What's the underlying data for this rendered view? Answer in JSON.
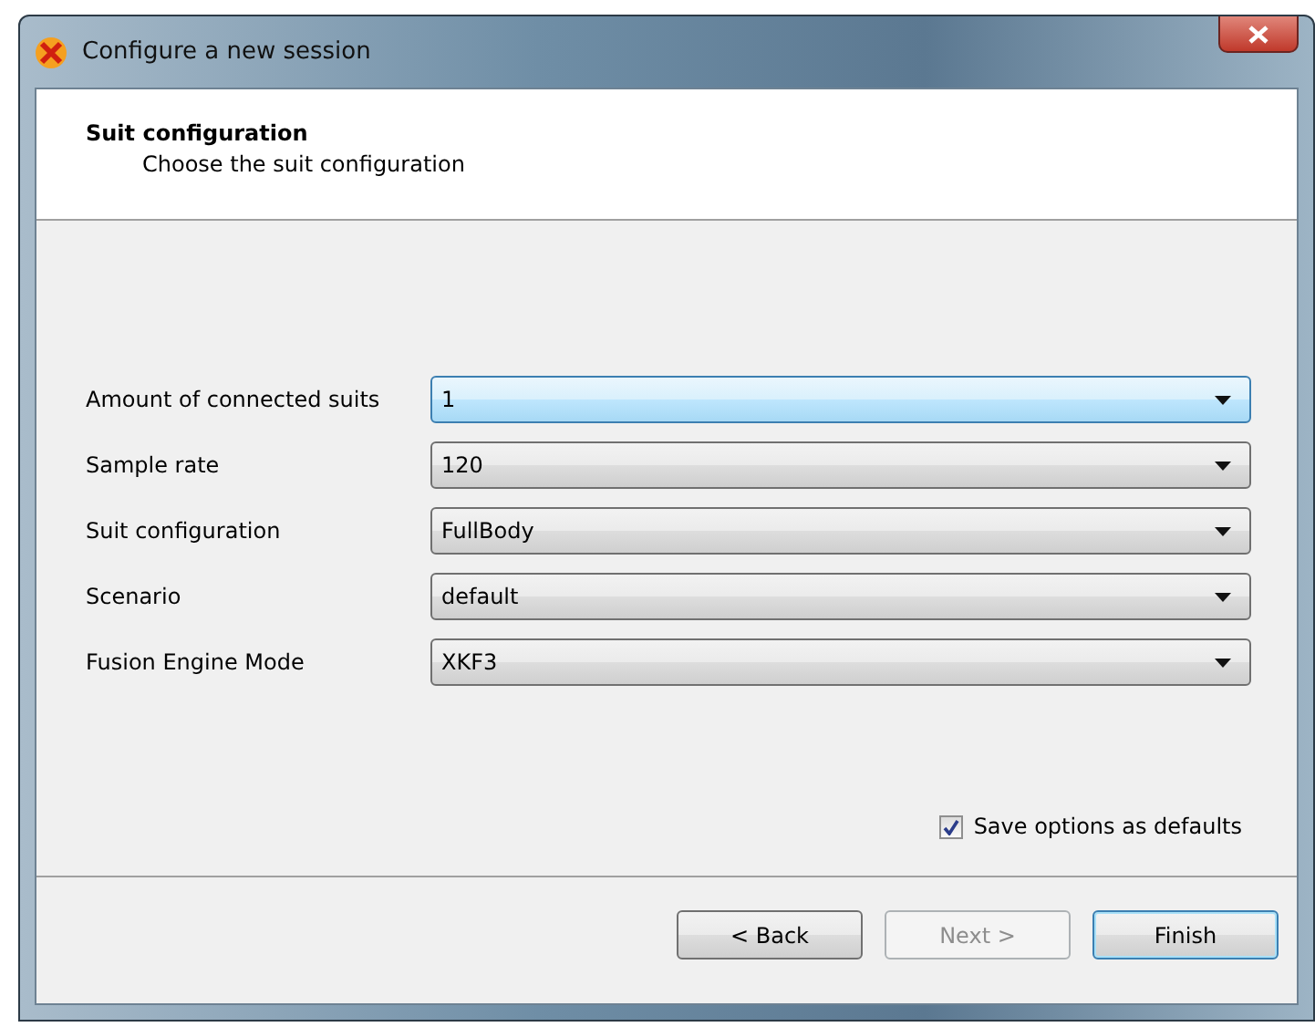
{
  "window": {
    "title": "Configure a new session"
  },
  "header": {
    "title": "Suit configuration",
    "subtitle": "Choose the suit configuration"
  },
  "fields": [
    {
      "label": "Amount of connected suits",
      "value": "1",
      "focused": true
    },
    {
      "label": "Sample rate",
      "value": "120",
      "focused": false
    },
    {
      "label": "Suit configuration",
      "value": "FullBody",
      "focused": false
    },
    {
      "label": "Scenario",
      "value": "default",
      "focused": false
    },
    {
      "label": "Fusion Engine Mode",
      "value": "XKF3",
      "focused": false
    }
  ],
  "save_defaults": {
    "label": "Save options as defaults",
    "checked": true
  },
  "buttons": [
    {
      "label": "< Back",
      "disabled": false,
      "default": false
    },
    {
      "label": "Next >",
      "disabled": true,
      "default": false
    },
    {
      "label": "Finish",
      "disabled": false,
      "default": true
    }
  ]
}
